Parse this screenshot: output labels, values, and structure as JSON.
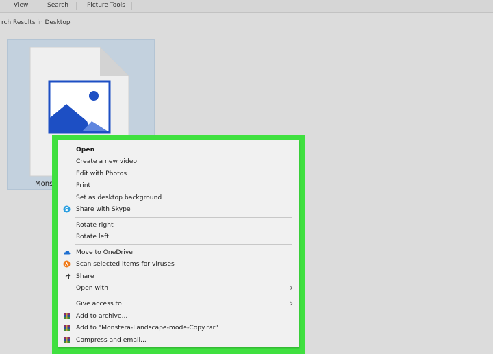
{
  "ribbon": {
    "tabs": [
      "View",
      "Search",
      "Picture Tools"
    ]
  },
  "path": {
    "text": "rch Results in Desktop"
  },
  "file": {
    "name": "Monst"
  },
  "context_menu": {
    "items": [
      {
        "label": "Open",
        "bold": true,
        "icon": null
      },
      {
        "label": "Create a new video",
        "icon": null
      },
      {
        "label": "Edit with Photos",
        "icon": null
      },
      {
        "label": "Print",
        "icon": null
      },
      {
        "label": "Set as desktop background",
        "icon": null
      },
      {
        "label": "Share with Skype",
        "icon": "skype-icon"
      },
      {
        "label": "Rotate right",
        "icon": null
      },
      {
        "label": "Rotate left",
        "icon": null
      },
      {
        "label": "Move to OneDrive",
        "icon": "onedrive-icon"
      },
      {
        "label": "Scan selected items for viruses",
        "icon": "antivirus-icon"
      },
      {
        "label": "Share",
        "icon": "share-icon"
      },
      {
        "label": "Open with",
        "icon": null,
        "submenu": true
      },
      {
        "label": "Give access to",
        "icon": null,
        "submenu": true
      },
      {
        "label": "Add to archive...",
        "icon": "winrar-icon"
      },
      {
        "label": "Add to \"Monstera-Landscape-mode-Copy.rar\"",
        "icon": "winrar-icon"
      },
      {
        "label": "Compress and email...",
        "icon": "winrar-icon"
      }
    ],
    "submenu_glyph": "›"
  },
  "colors": {
    "highlight_frame": "#3fe03f",
    "selection": "#c3d1de",
    "image_icon_blue": "#1d4fc4"
  }
}
